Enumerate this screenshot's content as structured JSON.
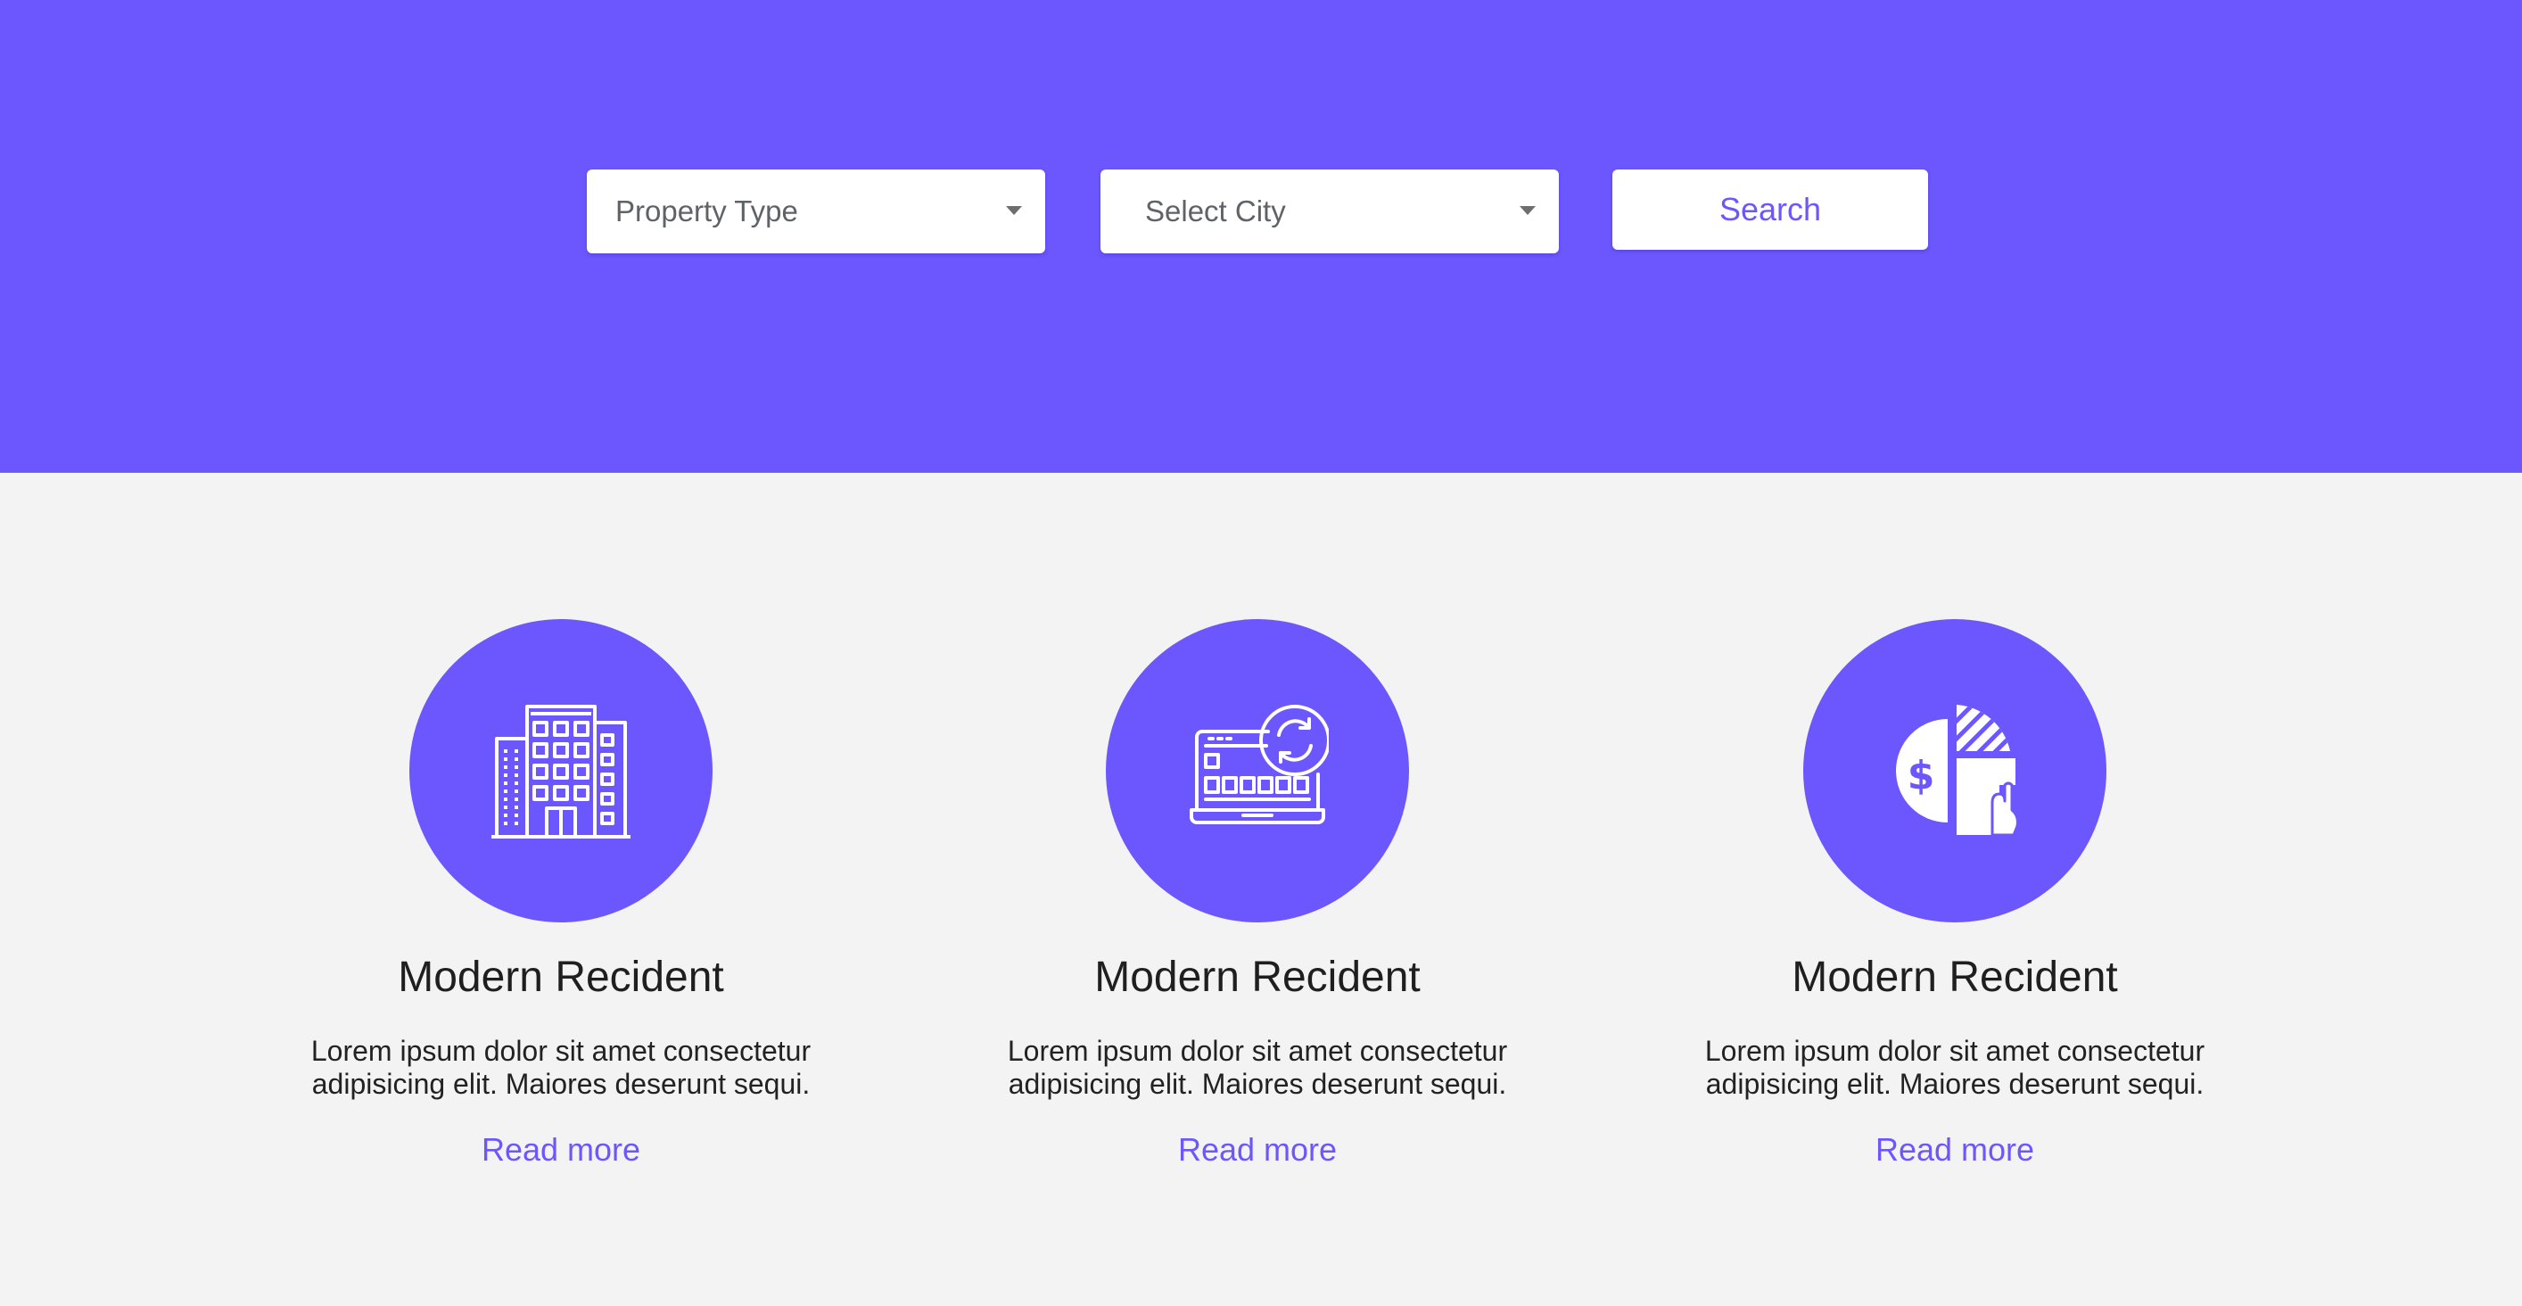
{
  "colors": {
    "accent": "#6c57ff",
    "background": "#f3f3f3",
    "card_title": "#1f1f1f",
    "body_text": "#222222"
  },
  "search_bar": {
    "property_type": {
      "value": "Property Type",
      "icon": "chevron-down-icon"
    },
    "city": {
      "value": "Select City",
      "icon": "chevron-down-icon"
    },
    "search_label": "Search"
  },
  "features": [
    {
      "icon": "building-icon",
      "title": "Modern Recident",
      "line1": "Lorem ipsum dolor sit amet consectetur",
      "line2": "adipisicing elit. Maiores deserunt sequi.",
      "link": "Read more"
    },
    {
      "icon": "laptop-refresh-icon",
      "title": "Modern Recident",
      "line1": "Lorem ipsum dolor sit amet consectetur",
      "line2": "adipisicing elit. Maiores deserunt sequi.",
      "link": "Read more"
    },
    {
      "icon": "finance-pie-chart-icon",
      "title": "Modern Recident",
      "line1": "Lorem ipsum dolor sit amet consectetur",
      "line2": "adipisicing elit. Maiores deserunt sequi.",
      "link": "Read more"
    }
  ]
}
